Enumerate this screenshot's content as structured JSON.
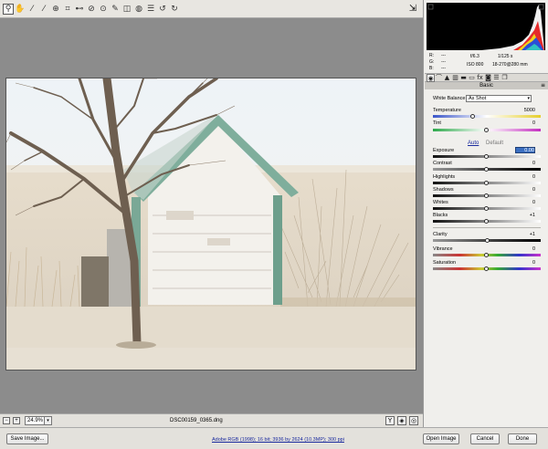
{
  "toolbar": {
    "tools": [
      {
        "icon": "zoom-icon",
        "glyph": "⚲"
      },
      {
        "icon": "hand-icon",
        "glyph": "✋"
      },
      {
        "icon": "white-balance-icon",
        "glyph": "⁄"
      },
      {
        "icon": "color-sampler-icon",
        "glyph": "⁄"
      },
      {
        "icon": "targeted-adjustment-icon",
        "glyph": "⊕"
      },
      {
        "icon": "crop-icon",
        "glyph": "⌗"
      },
      {
        "icon": "straighten-icon",
        "glyph": "⊷"
      },
      {
        "icon": "spot-removal-icon",
        "glyph": "⊘"
      },
      {
        "icon": "red-eye-icon",
        "glyph": "⊙"
      },
      {
        "icon": "adjustment-brush-icon",
        "glyph": "✎"
      },
      {
        "icon": "graduated-filter-icon",
        "glyph": "◫"
      },
      {
        "icon": "radial-filter-icon",
        "glyph": "◍"
      },
      {
        "icon": "preferences-list-icon",
        "glyph": "☰"
      },
      {
        "icon": "rotate-left-icon",
        "glyph": "↺"
      },
      {
        "icon": "rotate-right-icon",
        "glyph": "↻"
      }
    ],
    "fullscreen_glyph": "⇲"
  },
  "info": {
    "r_label": "R:",
    "g_label": "G:",
    "b_label": "B:",
    "r_value": "---",
    "g_value": "---",
    "b_value": "---",
    "aperture": "f/6.3",
    "shutter": "1/125 s",
    "iso": "ISO 800",
    "lens": "18-270@280 mm"
  },
  "panel": {
    "title": "Basic",
    "menu_glyph": "≡",
    "white_balance_label": "White Balance:",
    "white_balance_value": "As Shot",
    "temperature_label": "Temperature",
    "temperature_value": "5000",
    "tint_label": "Tint",
    "tint_value": "0",
    "auto_label": "Auto",
    "default_label": "Default",
    "exposure_label": "Exposure",
    "exposure_value": "0.00",
    "contrast_label": "Contrast",
    "contrast_value": "0",
    "highlights_label": "Highlights",
    "highlights_value": "0",
    "shadows_label": "Shadows",
    "shadows_value": "0",
    "whites_label": "Whites",
    "whites_value": "0",
    "blacks_label": "Blacks",
    "blacks_value": "+1",
    "clarity_label": "Clarity",
    "clarity_value": "+1",
    "vibrance_label": "Vibrance",
    "vibrance_value": "0",
    "saturation_label": "Saturation",
    "saturation_value": "0"
  },
  "preview": {
    "zoom": "24.9%",
    "filename": "DSC00159_0365.dng"
  },
  "footer": {
    "save_label": "Save Image...",
    "workflow": "Adobe RGB (1998); 16 bit; 3936 by 2624 (10.3MP); 300 ppi",
    "open_label": "Open Image",
    "cancel_label": "Cancel",
    "done_label": "Done"
  },
  "colors": {
    "accent": "#3b6fc1",
    "preview_bg": "#8c8c8c"
  }
}
